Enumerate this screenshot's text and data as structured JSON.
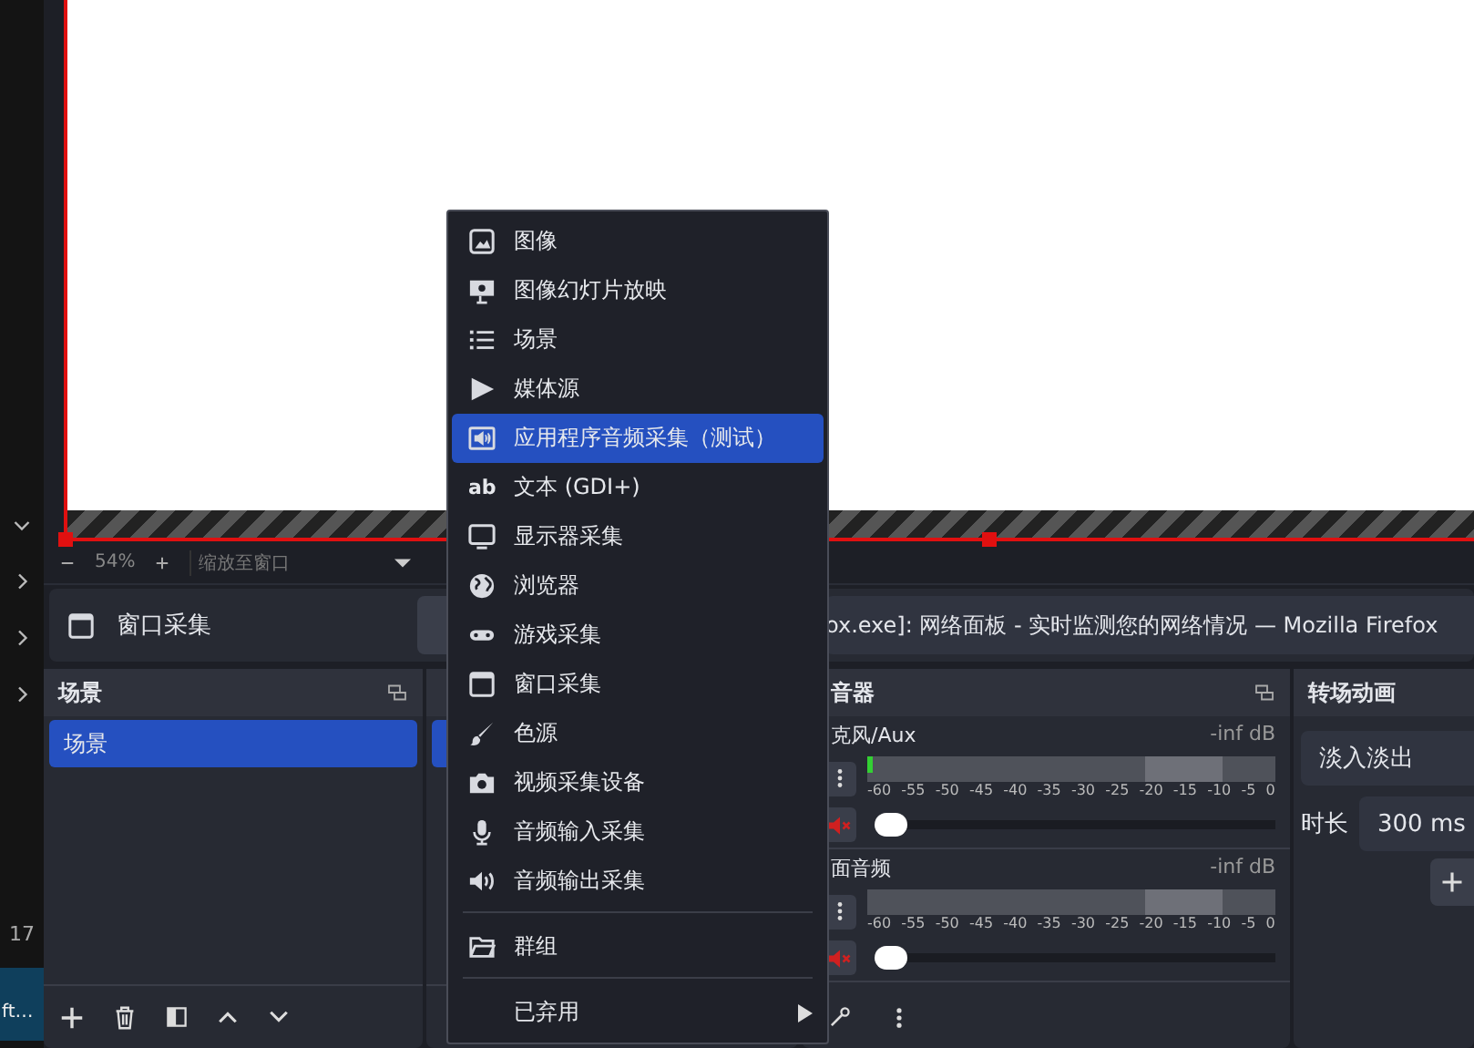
{
  "desktop_strip": {
    "line_count": "17",
    "taskbar_label": "ft…"
  },
  "preview": {
    "zoom": "54%",
    "zoom_mode": "缩放至窗口"
  },
  "source_toolbar": {
    "source_name": "窗口采集",
    "window_value": "ox.exe]: 网络面板 - 实时监测您的网络情况 — Mozilla Firefox"
  },
  "scenes": {
    "title": "场景",
    "items": [
      {
        "label": "场景",
        "selected": true
      }
    ]
  },
  "sources": {
    "rows": [
      {
        "selected": true
      }
    ]
  },
  "mixer": {
    "title": "音器",
    "channels": [
      {
        "name": "克风/Aux",
        "reading": "-inf dB",
        "muted": true,
        "meter": {
          "level": 0.012
        },
        "fader": {
          "level": 0
        },
        "scale": [
          "-60",
          "-55",
          "-50",
          "-45",
          "-40",
          "-35",
          "-30",
          "-25",
          "-20",
          "-15",
          "-10",
          "-5",
          "0"
        ]
      },
      {
        "name": "面音频",
        "reading": "-inf dB",
        "muted": true,
        "meter": {
          "level": 0
        },
        "fader": {
          "level": 0
        },
        "scale": [
          "-60",
          "-55",
          "-50",
          "-45",
          "-40",
          "-35",
          "-30",
          "-25",
          "-20",
          "-15",
          "-10",
          "-5",
          "0"
        ]
      }
    ]
  },
  "transitions": {
    "title": "转场动画",
    "transition": "淡入淡出",
    "duration_label": "时长",
    "duration": "300 ms"
  },
  "context_menu": {
    "items": [
      {
        "kind": "image",
        "label": "图像",
        "selected": false
      },
      {
        "kind": "slideshow",
        "label": "图像幻灯片放映",
        "selected": false
      },
      {
        "kind": "list",
        "label": "场景",
        "selected": false
      },
      {
        "kind": "play",
        "label": "媒体源",
        "selected": false
      },
      {
        "kind": "app-audio",
        "label": "应用程序音频采集（测试）",
        "selected": true
      },
      {
        "kind": "text",
        "icon_text": "ab",
        "label": "文本 (GDI+)",
        "selected": false
      },
      {
        "kind": "monitor",
        "label": "显示器采集",
        "selected": false
      },
      {
        "kind": "globe",
        "label": "浏览器",
        "selected": false
      },
      {
        "kind": "gamepad",
        "label": "游戏采集",
        "selected": false
      },
      {
        "kind": "window",
        "label": "窗口采集",
        "selected": false
      },
      {
        "kind": "brush",
        "label": "色源",
        "selected": false
      },
      {
        "kind": "camera",
        "label": "视频采集设备",
        "selected": false
      },
      {
        "kind": "mic",
        "label": "音频输入采集",
        "selected": false
      },
      {
        "kind": "speaker",
        "label": "音频输出采集",
        "selected": false
      },
      {
        "kind": "folder",
        "label": "群组",
        "selected": false,
        "separator_before": true
      },
      {
        "kind": "submenu",
        "label": "已弃用",
        "selected": false,
        "separator_before": true
      }
    ]
  }
}
